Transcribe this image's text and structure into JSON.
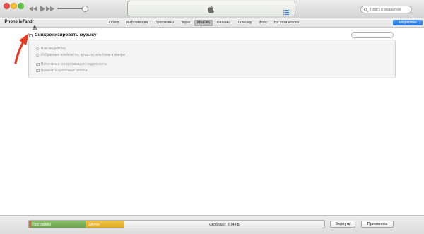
{
  "toolbar": {
    "search_placeholder": "Поиск в медиатеке"
  },
  "device": {
    "name": "iPhone le7andr"
  },
  "tabs": [
    {
      "label": "Обзор"
    },
    {
      "label": "Информация"
    },
    {
      "label": "Программы"
    },
    {
      "label": "Звуки"
    },
    {
      "label": "Музыка",
      "active": true
    },
    {
      "label": "Фильмы"
    },
    {
      "label": "Телешоу"
    },
    {
      "label": "Фото"
    },
    {
      "label": "На этом iPhone"
    }
  ],
  "media_button": "Медиатека",
  "sync": {
    "title": "Синхронизировать музыку",
    "checked": false,
    "options": {
      "all_library": "Всю медиатеку",
      "selected": "Избранные плейлисты, артисты, альбомы и жанры",
      "include_videos": "Включать в синхронизацию видеоклипы",
      "include_voice_memos": "Включать голосовые записи"
    }
  },
  "capacity": {
    "apps_label": "Программы",
    "other_label": "Другое",
    "free_label": "Свободно: 8,74 ГБ",
    "apps_fraction": 0.19,
    "other_fraction": 0.13
  },
  "buttons": {
    "revert": "Вернуть",
    "apply": "Применить"
  },
  "colors": {
    "accent_blue": "#2a82e4",
    "apps_green": "#7bb05a",
    "other_yellow": "#ebb734",
    "arrow_red": "#e8391f"
  },
  "icons": {
    "back": "rewind-icon",
    "play": "play-icon",
    "forward": "fast-forward-icon",
    "apple": "apple-logo-icon",
    "list": "list-icon",
    "search": "search-icon",
    "eject": "eject-icon",
    "arrow": "red-arrow-icon"
  }
}
